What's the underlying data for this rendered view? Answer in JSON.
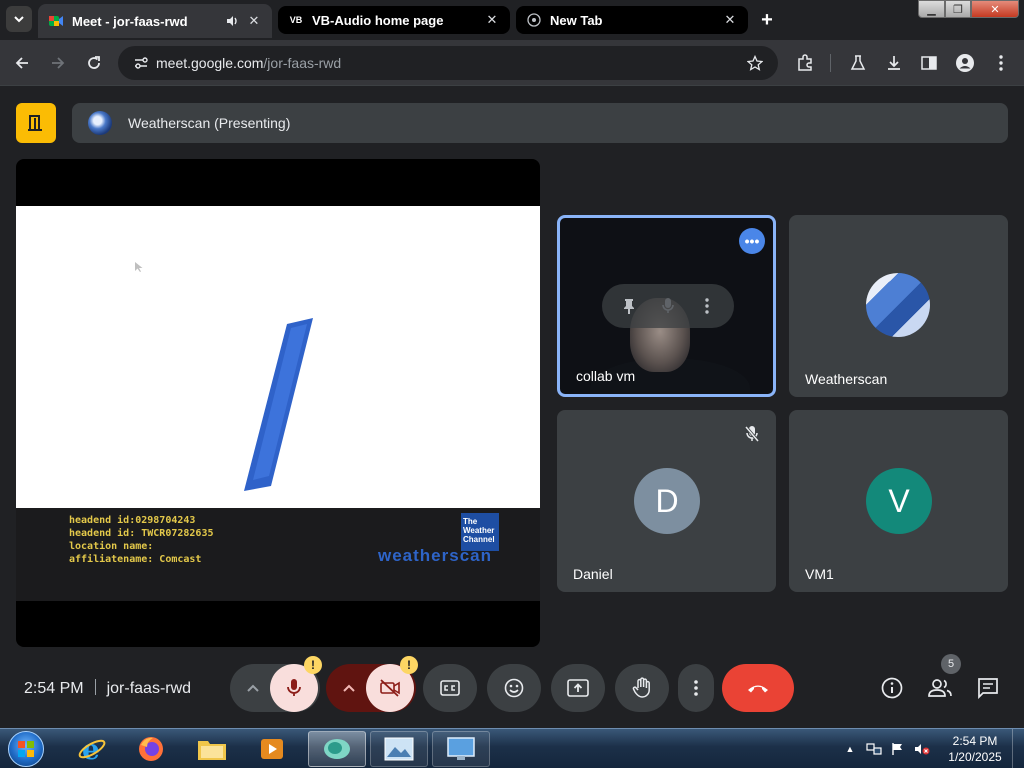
{
  "browser": {
    "tabs": [
      {
        "title": "Meet - jor-faas-rwd",
        "active": true,
        "audio": true
      },
      {
        "title": "VB-Audio home page",
        "active": false
      },
      {
        "title": "New Tab",
        "active": false
      }
    ],
    "url_host": "meet.google.com",
    "url_path": "/jor-faas-rwd"
  },
  "meet": {
    "presenting_label": "Weatherscan (Presenting)",
    "shared_screen": {
      "info_lines": [
        "headend id:0298704243",
        "headend id: TWCR07282635",
        "location name:",
        "affiliatename: Comcast"
      ],
      "logo_text": [
        "The",
        "Weather",
        "Channel"
      ],
      "wordmark": "weatherscan"
    },
    "tiles": [
      {
        "name": "collab vm"
      },
      {
        "name": "Weatherscan"
      },
      {
        "name": "Daniel",
        "initial": "D",
        "color": "#7d8fa0",
        "muted": true
      },
      {
        "name": "VM1",
        "initial": "V",
        "color": "#13897a"
      }
    ],
    "time": "2:54 PM",
    "meeting_code": "jor-faas-rwd",
    "warning_badge": "!",
    "participant_count": "5",
    "colors": {
      "accent": "#8ab4f8",
      "end_call": "#ea4335",
      "off_state": "#f9dedc",
      "warning": "#fdd663",
      "app_badge": "#fbbc04"
    }
  },
  "taskbar": {
    "clock_time": "2:54 PM",
    "clock_date": "1/20/2025"
  }
}
